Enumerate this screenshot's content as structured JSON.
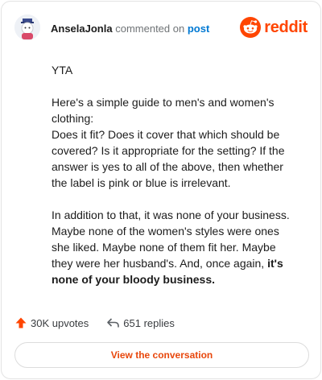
{
  "header": {
    "username": "AnselaJonla",
    "action_text": "commented on",
    "post_link": "post",
    "brand_word": "reddit"
  },
  "comment": {
    "p1": "YTA",
    "p2_line1": "Here's a simple guide to men's and women's clothing:",
    "p2_line2": "Does it fit? Does it cover that which should be covered? Is it appropriate for the setting? If the answer is yes to all of the above, then whether the label is pink or blue is irrelevant.",
    "p3_text": "In addition to that, it was none of your business. Maybe none of the women's styles were ones she liked. Maybe none of them fit her. Maybe they were her husband's. And, once again,",
    "p3_bold": "it's none of your bloody business."
  },
  "actions": {
    "upvotes": "30K upvotes",
    "replies": "651 replies"
  },
  "cta_label": "View the conversation",
  "colors": {
    "brand": "#ff4500",
    "link": "#0079d3",
    "upvote": "#ff4500"
  }
}
